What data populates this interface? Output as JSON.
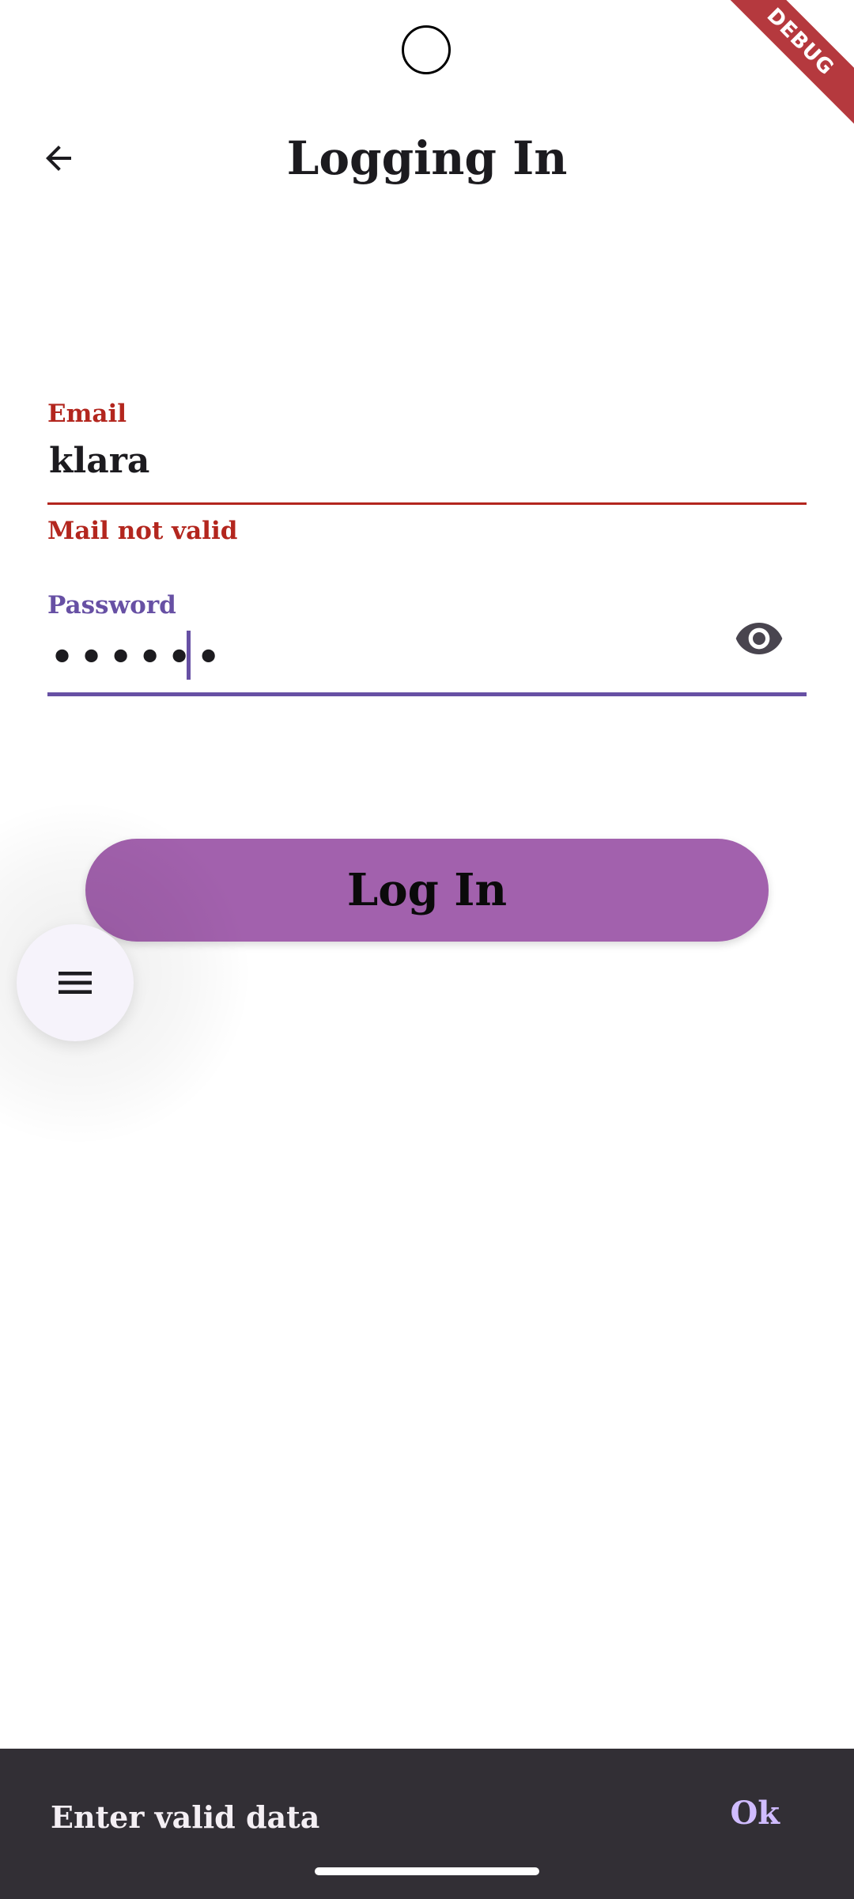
{
  "status": {
    "debug_banner": "DEBUG"
  },
  "appbar": {
    "title": "Logging In",
    "back_icon": "arrow-back-icon"
  },
  "form": {
    "email": {
      "label": "Email",
      "value": "klara",
      "error": "Mail not valid",
      "color": "#b3261e"
    },
    "password": {
      "label": "Password",
      "masked_value": "••••••",
      "visibility_icon": "eye-icon",
      "color": "#6750a4"
    }
  },
  "login_button": {
    "label": "Log In",
    "color": "#a261ad"
  },
  "fab": {
    "icon": "menu-icon"
  },
  "snackbar": {
    "message": "Enter valid data",
    "action": "Ok",
    "action_color": "#d0bcff"
  }
}
